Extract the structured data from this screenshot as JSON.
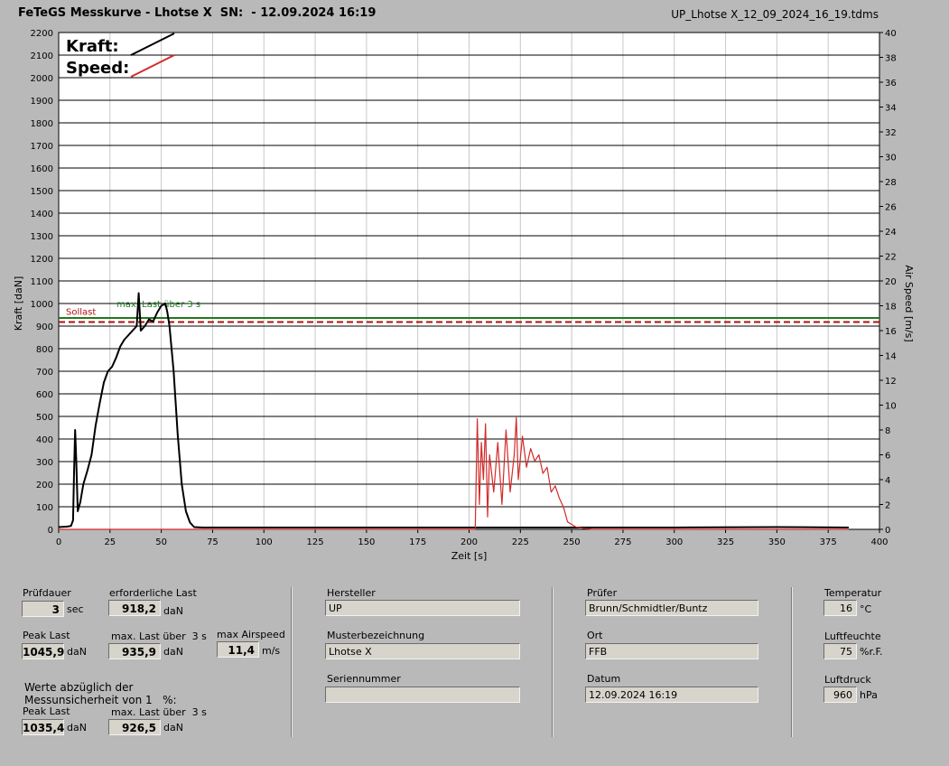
{
  "header": {
    "title": "FeTeGS Messkurve - Lhotse X  SN:  - 12.09.2024 16:19",
    "filename": "UP_Lhotse X_12_09_2024_16_19.tdms"
  },
  "chart_data": {
    "type": "line",
    "xlabel": "Zeit [s]",
    "ylabel": "Kraft [daN]",
    "y2label": "Air Speed [m/s]",
    "xlim": [
      0,
      400
    ],
    "ylim": [
      0,
      2200
    ],
    "y2lim": [
      0,
      40
    ],
    "x_ticks": [
      "0",
      "25",
      "50",
      "75",
      "100",
      "125",
      "150",
      "175",
      "200",
      "225",
      "250",
      "275",
      "300",
      "325",
      "350",
      "375",
      "400"
    ],
    "y_ticks": [
      "0",
      "100",
      "200",
      "300",
      "400",
      "500",
      "600",
      "700",
      "800",
      "900",
      "1000",
      "1100",
      "1200",
      "1300",
      "1400",
      "1500",
      "1600",
      "1700",
      "1800",
      "1900",
      "2000",
      "2100",
      "2200"
    ],
    "y2_ticks": [
      "0",
      "2",
      "4",
      "6",
      "8",
      "10",
      "12",
      "14",
      "16",
      "18",
      "20",
      "22",
      "24",
      "26",
      "28",
      "30",
      "32",
      "34",
      "36",
      "38",
      "40"
    ],
    "grid": true,
    "legend": [
      {
        "name": "Kraft:",
        "color": "#000000"
      },
      {
        "name": "Speed:",
        "color": "#d42a2a"
      }
    ],
    "annotations": [
      {
        "text": "Sollast",
        "y": 918.2,
        "color": "#b01010",
        "style": "dashed"
      },
      {
        "text": "max. Last über  3 s",
        "y": 935.9,
        "color": "#1f7a1f",
        "style": "solid"
      }
    ],
    "series": [
      {
        "name": "Kraft",
        "axis": "left",
        "color": "#000000",
        "x": [
          0,
          4,
          6,
          7,
          7.5,
          8,
          8.6,
          9.3,
          10.5,
          12,
          14,
          16,
          18,
          20,
          22,
          24,
          26,
          28,
          30,
          32,
          34,
          36,
          38,
          39,
          40,
          42,
          44,
          46,
          48,
          50,
          52,
          53,
          54,
          56,
          58,
          60,
          62,
          64,
          66,
          70,
          100,
          150,
          200,
          250,
          300,
          350,
          385
        ],
        "y": [
          10,
          12,
          15,
          40,
          250,
          440,
          300,
          80,
          120,
          200,
          260,
          330,
          460,
          560,
          650,
          700,
          720,
          760,
          810,
          840,
          860,
          880,
          900,
          1046,
          880,
          900,
          930,
          920,
          960,
          990,
          1000,
          960,
          900,
          700,
          420,
          200,
          80,
          30,
          10,
          8,
          8,
          8,
          8,
          8,
          8,
          10,
          8
        ]
      },
      {
        "name": "Speed",
        "axis": "right",
        "color": "#d42a2a",
        "x": [
          0,
          200,
          203,
          204,
          205,
          206,
          207,
          208,
          209,
          210,
          212,
          214,
          216,
          218,
          220,
          222,
          223,
          224,
          226,
          228,
          230,
          232,
          234,
          236,
          238,
          240,
          242,
          244,
          246,
          248,
          250,
          252,
          255,
          260,
          300,
          385
        ],
        "y": [
          0,
          0,
          0,
          8.9,
          2,
          7,
          4,
          8.5,
          1,
          6,
          3,
          7,
          2,
          8,
          3,
          6,
          9,
          4,
          7.5,
          5,
          6.5,
          5.5,
          6,
          4.5,
          5,
          3,
          3.5,
          2.5,
          1.8,
          0.6,
          0.4,
          0.2,
          0.1,
          0,
          0,
          0
        ]
      }
    ]
  },
  "panel": {
    "pruefdauer": {
      "label": "Prüfdauer",
      "value": "3",
      "unit": "sec"
    },
    "erforderliche_last": {
      "label": "erforderliche Last",
      "value": "918,2",
      "unit": "daN"
    },
    "peak_last": {
      "label": "Peak Last",
      "value": "1045,9",
      "unit": "daN"
    },
    "max_last": {
      "label": "max. Last über  3 s",
      "value": "935,9",
      "unit": "daN"
    },
    "max_airspeed": {
      "label": "max Airspeed",
      "value": "11,4",
      "unit": "m/s"
    },
    "werte_title": "Werte abzüglich der\nMessunsicherheit von 1   %:",
    "peak_last_corr": {
      "label": "Peak Last",
      "value": "1035,4",
      "unit": "daN"
    },
    "max_last_corr": {
      "label": "max. Last über  3 s",
      "value": "926,5",
      "unit": "daN"
    },
    "hersteller": {
      "label": "Hersteller",
      "value": "UP"
    },
    "muster": {
      "label": "Musterbezeichnung",
      "value": "Lhotse X"
    },
    "serien": {
      "label": "Seriennummer",
      "value": ""
    },
    "pruefer": {
      "label": "Prüfer",
      "value": "Brunn/Schmidtler/Buntz"
    },
    "ort": {
      "label": "Ort",
      "value": "FFB"
    },
    "datum": {
      "label": "Datum",
      "value": "12.09.2024 16:19"
    },
    "temperatur": {
      "label": "Temperatur",
      "value": "16",
      "unit": "°C"
    },
    "luftfeuchte": {
      "label": "Luftfeuchte",
      "value": "75",
      "unit": "%r.F."
    },
    "luftdruck": {
      "label": "Luftdruck",
      "value": "960",
      "unit": "hPa"
    }
  },
  "colors": {
    "background": "#b9b9b9",
    "plot_background": "#ffffff",
    "kraft": "#000000",
    "speed": "#d42a2a",
    "sollast": "#b01010",
    "maxlast": "#1f7a1f"
  }
}
